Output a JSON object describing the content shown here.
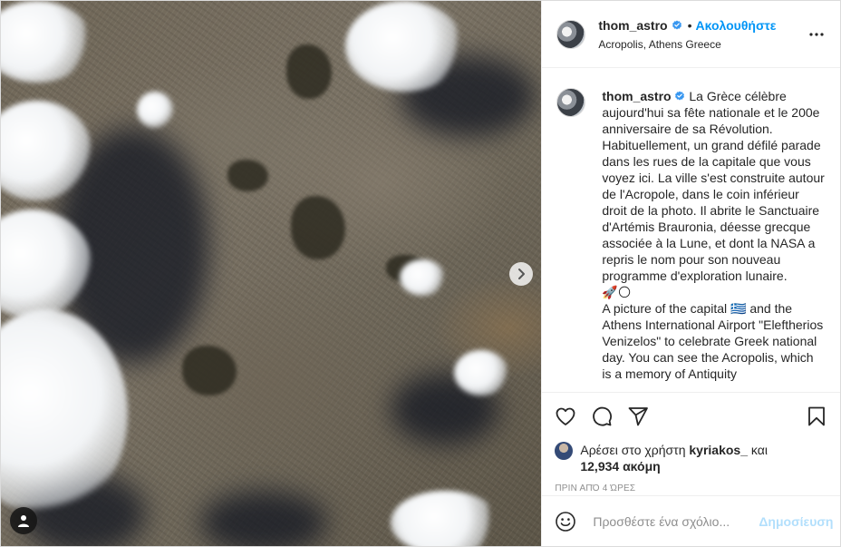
{
  "post": {
    "user": {
      "username": "thom_astro",
      "follow_label": "Ακολουθήστε",
      "location": "Acropolis, Athens Greece",
      "verified": true
    },
    "caption": "La Grèce célèbre aujourd'hui sa fête nationale et le 200e anniversaire de sa Révolution. Habituellement, un grand défilé parade dans les rues de la capitale que vous voyez ici. La ville s'est construite autour de l'Acropole, dans le coin inférieur droit de la photo. Il abrite le Sanctuaire d'Artémis Brauronia, déesse grecque associée à la Lune, et dont la NASA a repris le nom pour son nouveau programme d'exploration lunaire.\n🚀🌕\nA picture of the capital 🇬🇷 and the Athens International Airport \"Eleftherios Venizelos\" to celebrate Greek national day. You can see the Acropolis, which is a memory of Antiquity",
    "likes": {
      "prefix": "Αρέσει στο χρήστη",
      "liker": "kyriakos_",
      "conj": "και",
      "count": "12,934 ακόμη"
    },
    "time": "ΠΡΙΝ ΑΠΌ 4 ΏΡΕΣ"
  },
  "comment": {
    "placeholder": "Προσθέστε ένα σχόλιο...",
    "post_label": "Δημοσίευση"
  },
  "icons": {
    "like": "heart-icon",
    "comment": "comment-icon",
    "share": "share-icon",
    "save": "bookmark-icon",
    "more": "more-icon",
    "emoji": "emoji-icon",
    "next": "chevron-right-icon",
    "tag": "user-tag-icon"
  },
  "colors": {
    "accent": "#0095f6",
    "verified": "#3897f0",
    "post_disabled": "#b2dffc"
  }
}
